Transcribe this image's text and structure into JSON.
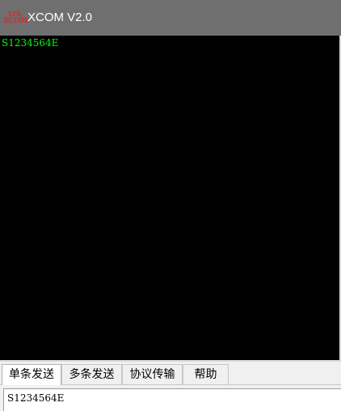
{
  "window": {
    "title": "XCOM V2.0",
    "logo_line1": "ATK",
    "logo_line2": "XCOM"
  },
  "receive_area": {
    "text": "S1234564E",
    "text_color": "#00ff00",
    "background": "#000000"
  },
  "tabs": [
    {
      "label": "单条发送",
      "active": true
    },
    {
      "label": "多条发送",
      "active": false
    },
    {
      "label": "协议传输",
      "active": false
    },
    {
      "label": "帮助",
      "active": false
    }
  ],
  "send_area": {
    "text": "S1234564E"
  },
  "colors": {
    "titlebar": "#6f6f6f",
    "logo": "#e0262a"
  }
}
